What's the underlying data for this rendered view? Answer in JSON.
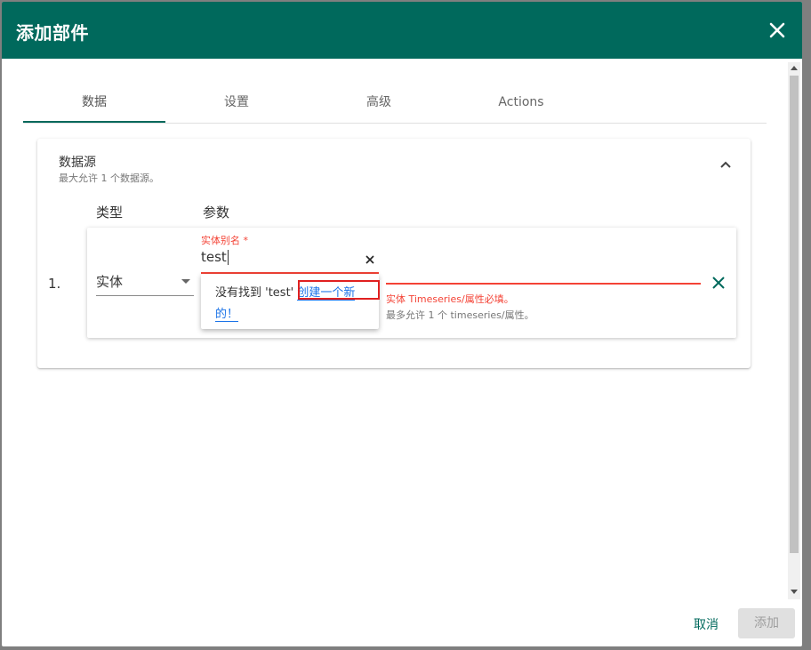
{
  "dialog": {
    "title": "添加部件",
    "close_icon": "close-icon"
  },
  "tabs": [
    {
      "label": "数据",
      "active": true
    },
    {
      "label": "设置",
      "active": false
    },
    {
      "label": "高级",
      "active": false
    },
    {
      "label": "Actions",
      "active": false
    }
  ],
  "datasources": {
    "title": "数据源",
    "subtitle": "最大允许 1 个数据源。",
    "col_type": "类型",
    "col_params": "参数",
    "row": {
      "index": "1.",
      "type_value": "实体",
      "alias_label": "实体别名 *",
      "alias_value": "test",
      "ts_error": "实体 Timeseries/属性必填。",
      "ts_hint": "最多允许 1 个 timeseries/属性。"
    }
  },
  "dropdown": {
    "not_found": "没有找到 'test'",
    "create_link": "创建一个新的！"
  },
  "footer": {
    "cancel_label": "取消",
    "add_label": "添加"
  },
  "colors": {
    "primary": "#00695c",
    "error": "#f44336",
    "link": "#1a73e8"
  }
}
